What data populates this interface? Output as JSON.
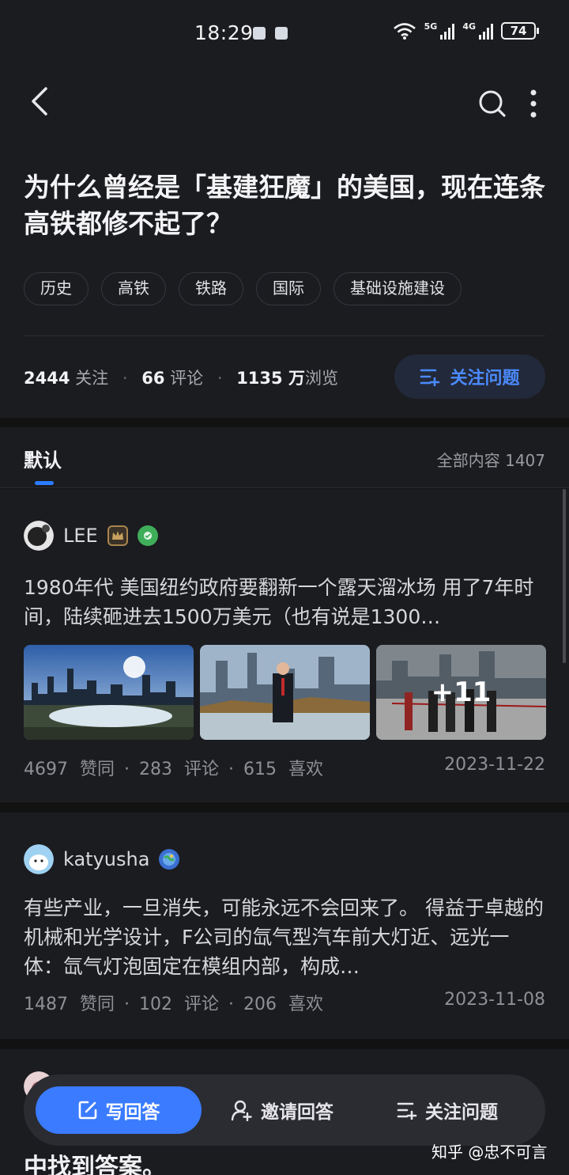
{
  "status_bar": {
    "time": "18:29",
    "net1": "5G",
    "net2": "4G",
    "battery": "74"
  },
  "nav": {
    "back_icon": "chevron-left-icon",
    "search_icon": "search-icon",
    "more_icon": "more-vertical-icon"
  },
  "question": {
    "title": "为什么曾经是「基建狂魔」的美国，现在连条高铁都修不起了？",
    "tags": [
      "历史",
      "高铁",
      "铁路",
      "国际",
      "基础设施建设"
    ],
    "followers": "2444",
    "followers_label": "关注",
    "comments": "66",
    "comments_label": "评论",
    "views": "1135 万",
    "views_label": "浏览",
    "follow_button": "关注问题"
  },
  "tabs": {
    "default": "默认",
    "all_content": "全部内容 1407"
  },
  "answers": [
    {
      "author": "LEE",
      "excerpt": "1980年代 美国纽约政府要翻新一个露天溜冰场 用了7年时间，陆续砸进去1500万美元（也有说是1300…",
      "images_more": "+11",
      "likes": "4697",
      "likes_label": "赞同",
      "comments": "283",
      "comments_label": "评论",
      "favs": "615",
      "favs_label": "喜欢",
      "date": "2023-11-22"
    },
    {
      "author": "katyusha",
      "excerpt": "有些产业，一旦消失，可能永远不会回来了。 得益于卓越的机械和光学设计，F公司的氙气型汽车前大灯近、远光一体：氙气灯泡固定在模组内部，构成…",
      "likes": "1487",
      "likes_label": "赞同",
      "comments": "102",
      "comments_label": "评论",
      "favs": "206",
      "favs_label": "喜欢",
      "date": "2023-11-08"
    }
  ],
  "peek": {
    "text": "中找到答案。"
  },
  "bottom_bar": {
    "write": "写回答",
    "invite": "邀请回答",
    "follow": "关注问题"
  },
  "watermark": "知乎 @忠不可言",
  "colors": {
    "accent": "#3a7bff",
    "background": "#121212",
    "card": "#1b1c20"
  }
}
